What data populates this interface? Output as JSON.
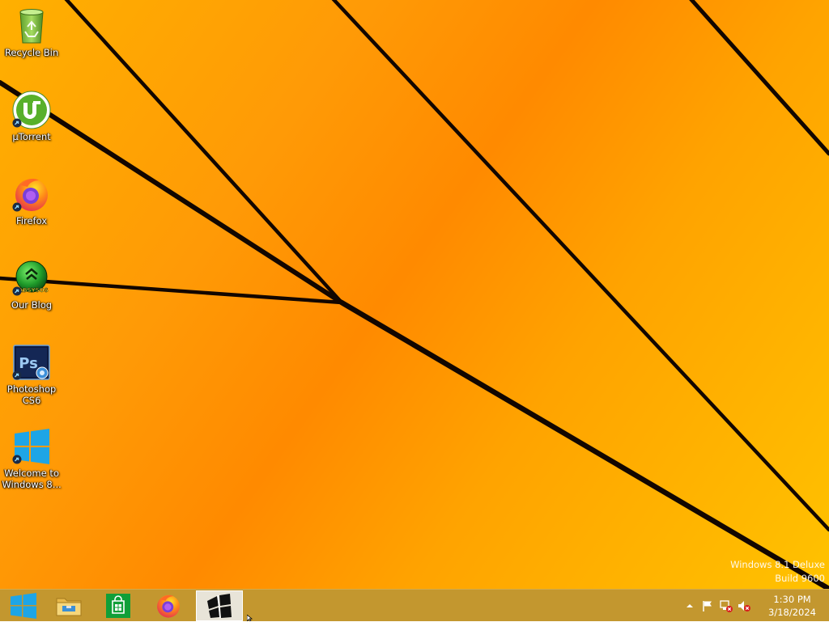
{
  "desktop": {
    "icons": [
      {
        "label": "Recycle Bin",
        "icon": "recycle-bin-icon"
      },
      {
        "label": "µTorrent",
        "icon": "utorrent-icon"
      },
      {
        "label": "Firefox",
        "icon": "firefox-icon"
      },
      {
        "label": "Our Blog",
        "icon": "blog-icon",
        "badge_text": "LABSYSOS"
      },
      {
        "label": "Photoshop\nCS6",
        "icon": "photoshop-icon",
        "badge_text": "Ps"
      },
      {
        "label": "Welcome to\nWindows 8...",
        "icon": "windows-logo-icon"
      }
    ],
    "watermark": {
      "line1": "Windows 8.1 Deluxe",
      "line2": "Build 9600"
    }
  },
  "taskbar": {
    "buttons": [
      {
        "icon": "start-windows-icon",
        "active": false
      },
      {
        "icon": "file-explorer-icon",
        "active": false
      },
      {
        "icon": "store-icon",
        "active": false
      },
      {
        "icon": "firefox-icon",
        "active": false
      },
      {
        "icon": "app-window-icon",
        "active": true
      }
    ],
    "tray": {
      "icons": [
        "show-hidden-icons-chevron-icon",
        "action-center-flag-icon",
        "network-error-icon",
        "volume-muted-icon"
      ],
      "time": "1:30 PM",
      "date": "3/18/2024"
    }
  },
  "colors": {
    "wallpaper": "#ff9a06",
    "taskbar": "#c3972f",
    "windows_blue": "#1ea5e6",
    "store_green": "#109f38"
  }
}
